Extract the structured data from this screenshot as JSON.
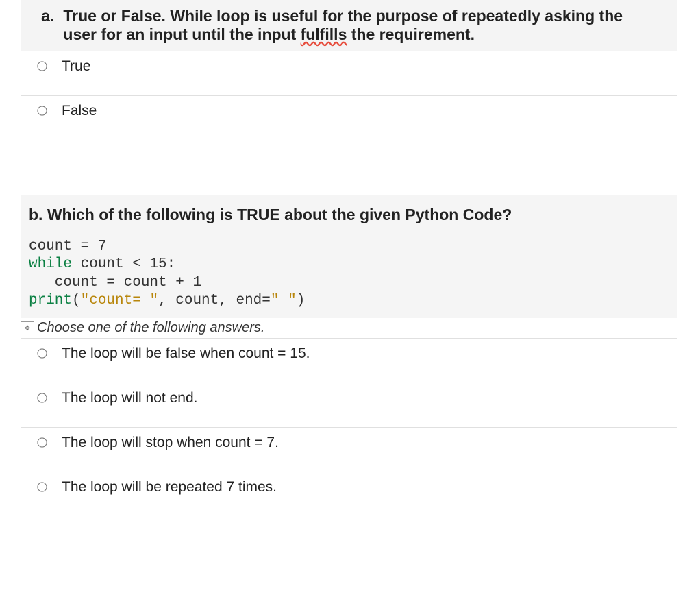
{
  "questionA": {
    "marker": "a.",
    "text_before": "True or False. While loop is useful for the purpose of repeatedly asking the user for an input until the input ",
    "spell_word": "fulfills",
    "text_after": " the requirement.",
    "options": [
      {
        "label": "True"
      },
      {
        "label": "False"
      }
    ]
  },
  "questionB": {
    "title": "b. Which of the following is TRUE about the given Python Code?",
    "code": {
      "line1_a": "count = 7",
      "line2_kw": "while",
      "line2_rest": " count < 15:",
      "line3": "   count = count + 1",
      "line4_fn": "print",
      "line4_p1": "(",
      "line4_str1": "\"count= \"",
      "line4_p2": ", count, end=",
      "line4_str2": "\" \"",
      "line4_p3": ")"
    },
    "instruction": "Choose one of the following answers.",
    "options": [
      {
        "label": "The loop will be false when count = 15."
      },
      {
        "label": "The loop will not end."
      },
      {
        "label": "The loop will stop when count = 7."
      },
      {
        "label": "The loop will be repeated 7 times."
      }
    ]
  }
}
